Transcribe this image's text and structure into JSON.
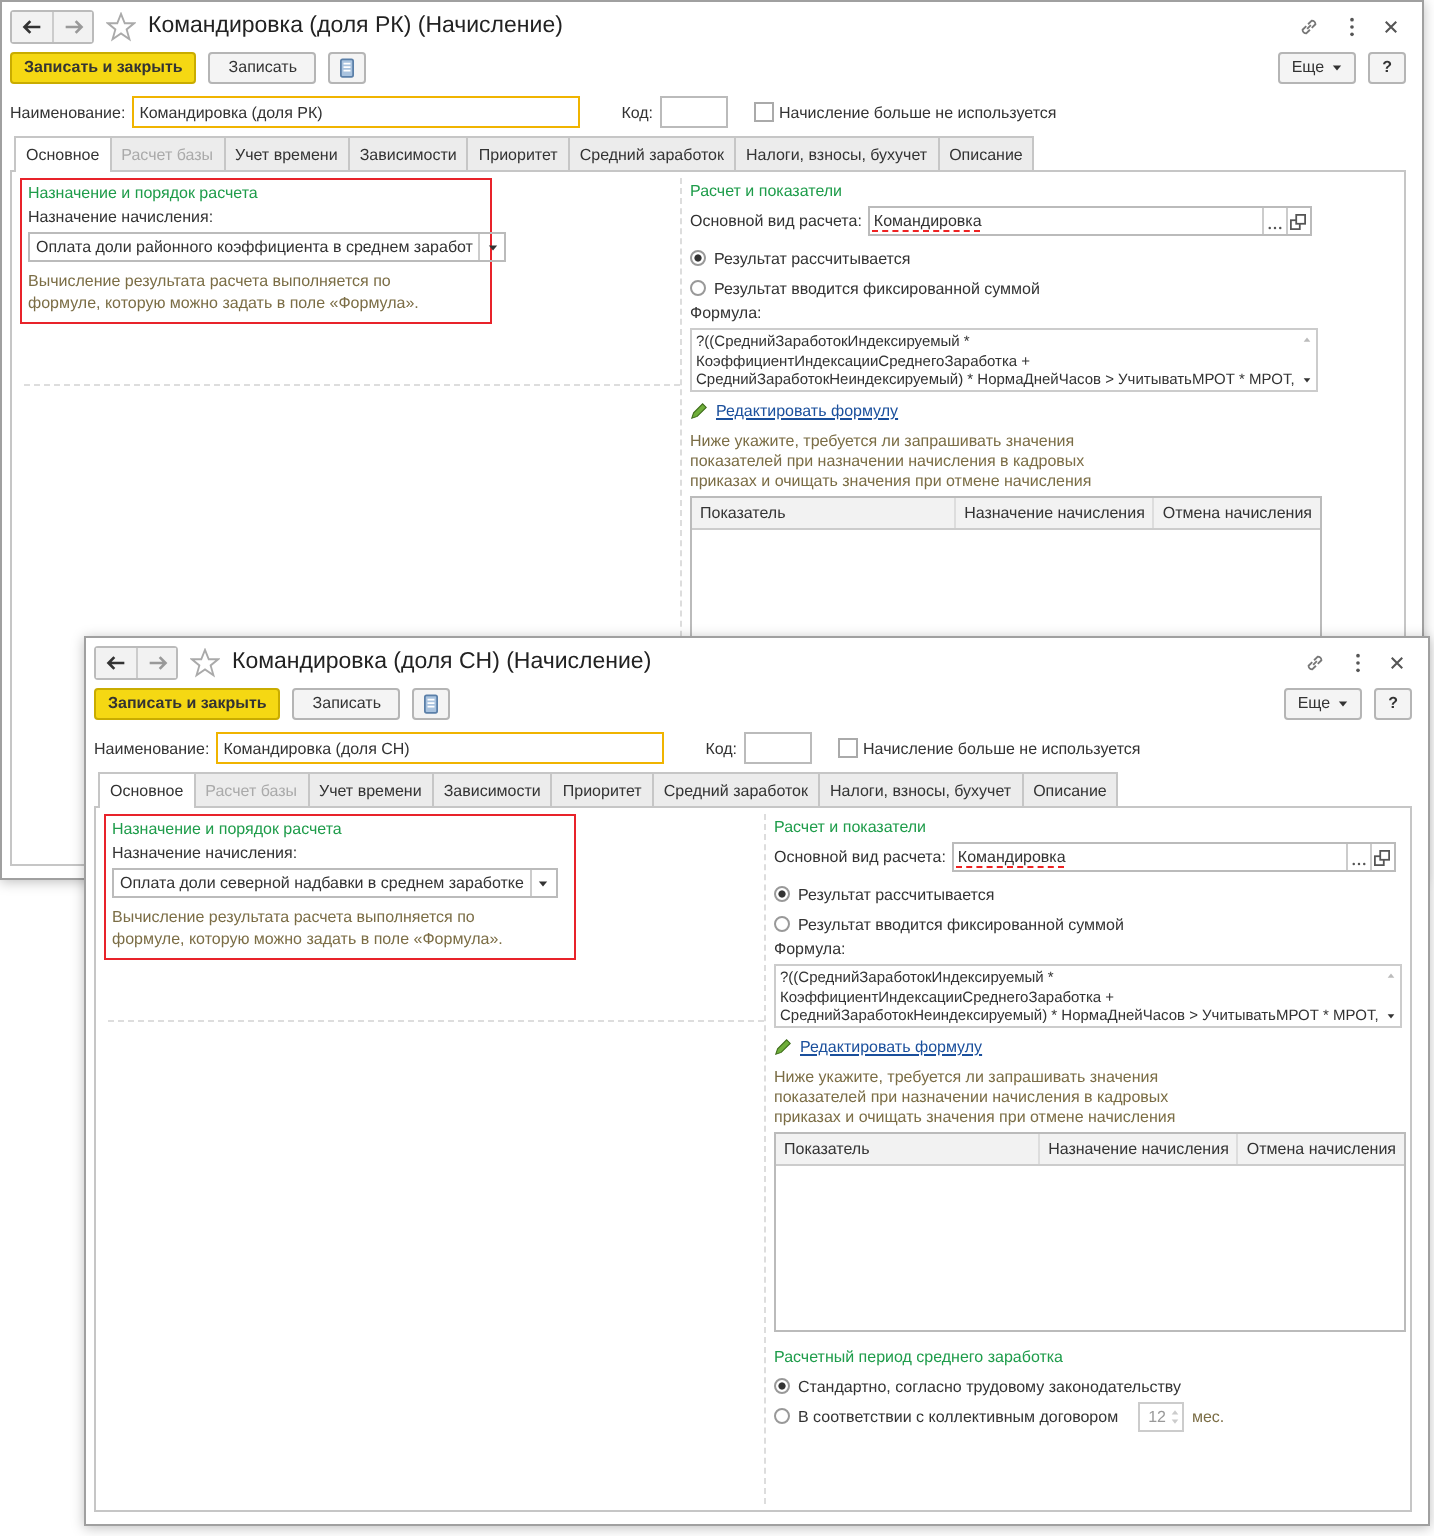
{
  "windows": [
    {
      "title": "Командировка (доля РК) (Начисление)",
      "toolbar": {
        "buttons": [
          {
            "label": "Записать и закрыть",
            "kind": "primary"
          },
          {
            "label": "Записать",
            "kind": "plain"
          }
        ],
        "more": "Еще",
        "help": "?"
      },
      "name_field": {
        "label": "Наименование:",
        "value": "Командировка (доля РК)",
        "focused": true
      },
      "code_field": {
        "label": "Код:"
      },
      "retired_checkbox": {
        "label": "Начисление больше не используется",
        "checked": false
      },
      "tabs": [
        {
          "label": "Основное",
          "selected": true,
          "disabled": false
        },
        {
          "label": "Расчет базы",
          "selected": false,
          "disabled": true
        },
        {
          "label": "Учет времени",
          "selected": false,
          "disabled": false
        },
        {
          "label": "Зависимости",
          "selected": false,
          "disabled": false
        },
        {
          "label": "Приоритет",
          "selected": false,
          "disabled": false
        },
        {
          "label": "Средний заработок",
          "selected": false,
          "disabled": false
        },
        {
          "label": "Налоги, взносы, бухучет",
          "selected": false,
          "disabled": false
        },
        {
          "label": "Описание",
          "selected": false,
          "disabled": false
        }
      ],
      "purpose_group": {
        "title": "Назначение и порядок расчета",
        "highlighted": true,
        "field_label": "Назначение начисления:",
        "value": "Оплата доли районного коэффициента в среднем заработ",
        "note": "Вычисление результата расчета выполняется по формуле, которую можно задать в поле «Формула»."
      },
      "calc_group": {
        "title": "Расчет и показатели",
        "base_label": "Основной вид расчета:",
        "base_value": "Командировка",
        "base_marked": true,
        "radios": [
          {
            "label": "Результат рассчитывается",
            "selected": true
          },
          {
            "label": "Результат вводится фиксированной суммой",
            "selected": false
          }
        ],
        "formula_label": "Формула:",
        "formula_lines": [
          "?((СреднийЗаработокИндексируемый *",
          "КоэффициентИндексацииСреднегоЗаработка +",
          "СреднийЗаработокНеиндексируемый) * НормаДнейЧасов > УчитыватьМРОТ * МРОТ,"
        ],
        "edit_link": "Редактировать формулу",
        "hint": "Ниже укажите, требуется ли запрашивать значения показателей при назначении начисления в кадровых приказах и очищать значения при отмене начисления",
        "columns": [
          "Показатель",
          "Назначение начисления",
          "Отмена начисления"
        ]
      }
    },
    {
      "title": "Командировка (доля СН) (Начисление)",
      "toolbar": {
        "buttons": [
          {
            "label": "Записать и закрыть",
            "kind": "primary"
          },
          {
            "label": "Записать",
            "kind": "plain"
          }
        ],
        "more": "Еще",
        "help": "?"
      },
      "name_field": {
        "label": "Наименование:",
        "value": "Командировка (доля СН)",
        "focused": true
      },
      "code_field": {
        "label": "Код:"
      },
      "retired_checkbox": {
        "label": "Начисление больше не используется",
        "checked": false
      },
      "tabs": [
        {
          "label": "Основное",
          "selected": true,
          "disabled": false
        },
        {
          "label": "Расчет базы",
          "selected": false,
          "disabled": true
        },
        {
          "label": "Учет времени",
          "selected": false,
          "disabled": false
        },
        {
          "label": "Зависимости",
          "selected": false,
          "disabled": false
        },
        {
          "label": "Приоритет",
          "selected": false,
          "disabled": false
        },
        {
          "label": "Средний заработок",
          "selected": false,
          "disabled": false
        },
        {
          "label": "Налоги, взносы, бухучет",
          "selected": false,
          "disabled": false
        },
        {
          "label": "Описание",
          "selected": false,
          "disabled": false
        }
      ],
      "purpose_group": {
        "title": "Назначение и порядок расчета",
        "highlighted": true,
        "field_label": "Назначение начисления:",
        "value": "Оплата доли северной надбавки в среднем заработке",
        "note": "Вычисление результата расчета выполняется по формуле, которую можно задать в поле «Формула»."
      },
      "calc_group": {
        "title": "Расчет и показатели",
        "base_label": "Основной вид расчета:",
        "base_value": "Командировка",
        "base_marked": true,
        "radios": [
          {
            "label": "Результат рассчитывается",
            "selected": true
          },
          {
            "label": "Результат вводится фиксированной суммой",
            "selected": false
          }
        ],
        "formula_label": "Формула:",
        "formula_lines": [
          "?((СреднийЗаработокИндексируемый *",
          "КоэффициентИндексацииСреднегоЗаработка +",
          "СреднийЗаработокНеиндексируемый) * НормаДнейЧасов > УчитыватьМРОТ * МРОТ,"
        ],
        "edit_link": "Редактировать формулу",
        "hint": "Ниже укажите, требуется ли запрашивать значения показателей при назначении начисления в кадровых приказах и очищать значения при отмене начисления",
        "columns": [
          "Показатель",
          "Назначение начисления",
          "Отмена начисления"
        ]
      },
      "period_group": {
        "title": "Расчетный период среднего заработка",
        "options": [
          {
            "label": "Стандартно, согласно трудовому законодательству",
            "selected": true
          },
          {
            "label": "В соответствии с коллективным договором",
            "selected": false,
            "months": "12",
            "unit": "мес."
          }
        ]
      }
    }
  ]
}
